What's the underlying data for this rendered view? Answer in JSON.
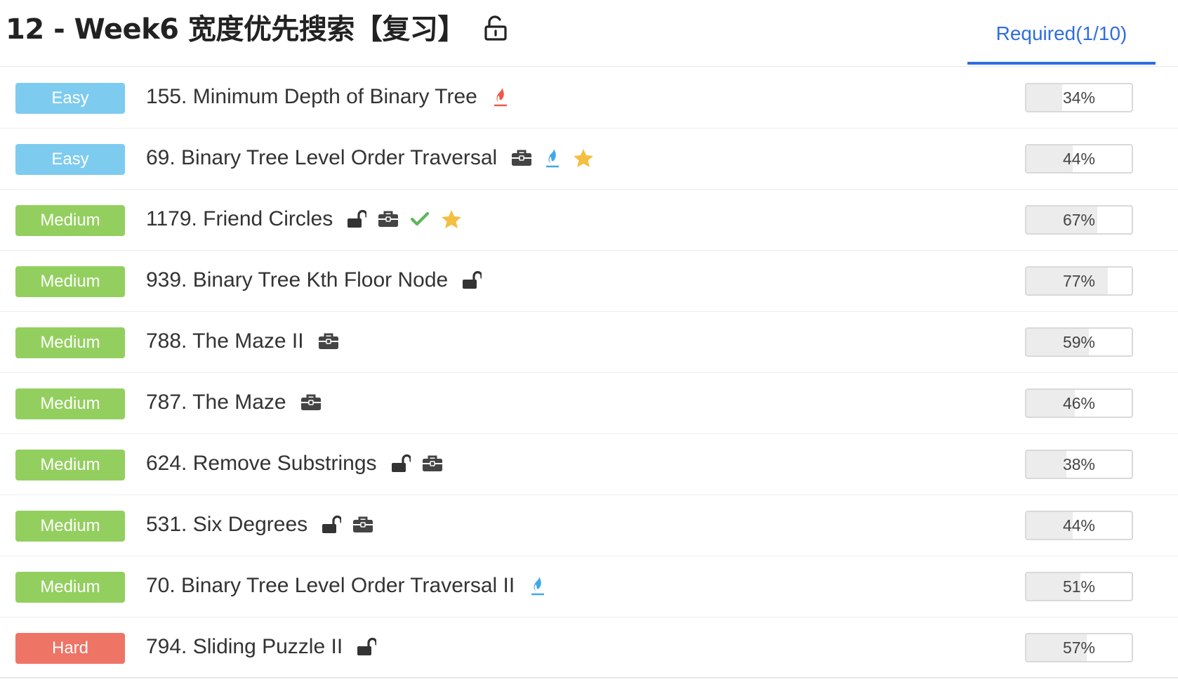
{
  "header": {
    "title": "12 - Week6 宽度优先搜索【复习】",
    "lock_icon": "unlock-icon",
    "tab_label": "Required(1/10)",
    "accent_color": "#2f6de1"
  },
  "difficulty_colors": {
    "Easy": "#7ecbf0",
    "Medium": "#93cf5f",
    "Hard": "#ee7466"
  },
  "problems": [
    {
      "difficulty": "Easy",
      "title": "155. Minimum Depth of Binary Tree",
      "icons": [
        "flame-red-icon"
      ],
      "acceptance": "34%",
      "acceptance_value": 34
    },
    {
      "difficulty": "Easy",
      "title": "69. Binary Tree Level Order Traversal",
      "icons": [
        "briefcase-icon",
        "flame-blue-icon",
        "star-icon"
      ],
      "acceptance": "44%",
      "acceptance_value": 44
    },
    {
      "difficulty": "Medium",
      "title": "1179. Friend Circles",
      "icons": [
        "unlock-icon",
        "briefcase-icon",
        "check-icon",
        "star-icon"
      ],
      "acceptance": "67%",
      "acceptance_value": 67
    },
    {
      "difficulty": "Medium",
      "title": "939. Binary Tree Kth Floor Node",
      "icons": [
        "unlock-icon"
      ],
      "acceptance": "77%",
      "acceptance_value": 77
    },
    {
      "difficulty": "Medium",
      "title": "788. The Maze II",
      "icons": [
        "briefcase-icon"
      ],
      "acceptance": "59%",
      "acceptance_value": 59
    },
    {
      "difficulty": "Medium",
      "title": "787. The Maze",
      "icons": [
        "briefcase-icon"
      ],
      "acceptance": "46%",
      "acceptance_value": 46
    },
    {
      "difficulty": "Medium",
      "title": "624. Remove Substrings",
      "icons": [
        "unlock-icon",
        "briefcase-icon"
      ],
      "acceptance": "38%",
      "acceptance_value": 38
    },
    {
      "difficulty": "Medium",
      "title": "531. Six Degrees",
      "icons": [
        "unlock-icon",
        "briefcase-icon"
      ],
      "acceptance": "44%",
      "acceptance_value": 44
    },
    {
      "difficulty": "Medium",
      "title": "70. Binary Tree Level Order Traversal II",
      "icons": [
        "flame-blue-icon"
      ],
      "acceptance": "51%",
      "acceptance_value": 51
    },
    {
      "difficulty": "Hard",
      "title": "794. Sliding Puzzle II",
      "icons": [
        "unlock-icon"
      ],
      "acceptance": "57%",
      "acceptance_value": 57
    }
  ]
}
